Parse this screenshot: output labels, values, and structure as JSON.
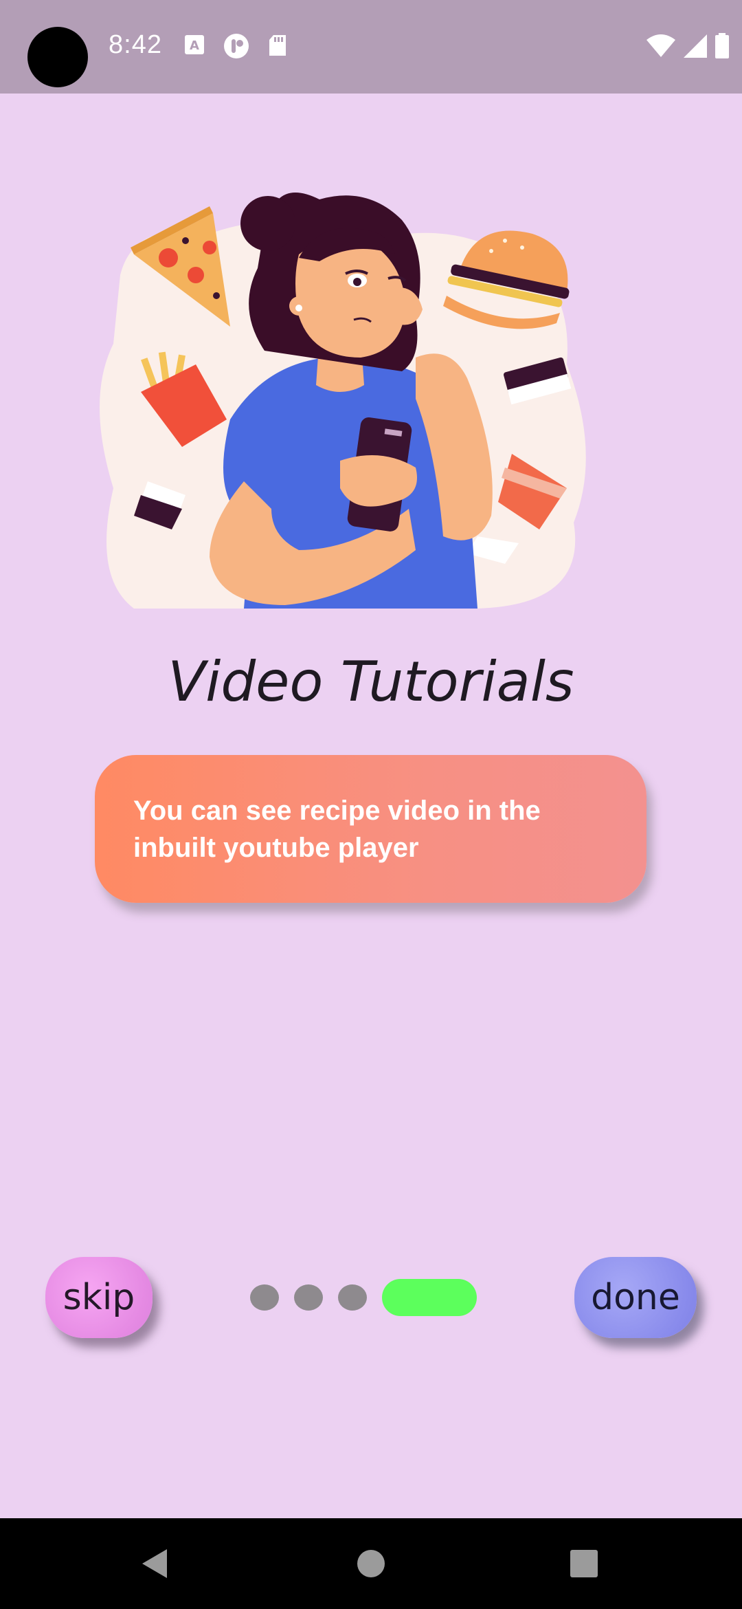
{
  "status_bar": {
    "time": "8:42",
    "icons": [
      "a-font-icon",
      "podcast-icon",
      "sd-card-icon",
      "wifi-icon",
      "signal-icon",
      "battery-icon"
    ]
  },
  "onboarding": {
    "title": "Video Tutorials",
    "description": "You can see recipe video in the inbuilt youtube player",
    "page_indicator": {
      "total": 4,
      "current": 4
    }
  },
  "buttons": {
    "skip_label": "skip",
    "done_label": "done"
  },
  "colors": {
    "background": "#ecd1f2",
    "status_bar": "#b39eb6",
    "card_start": "#ff8a63",
    "card_end": "#f3918f",
    "active_dot": "#5cff5c",
    "inactive_dot": "#8e8a8e",
    "skip_button": "#e58ae3",
    "done_button": "#8a8cec"
  },
  "nav_bar": {
    "icons": [
      "back-icon",
      "home-icon",
      "recents-icon"
    ]
  }
}
